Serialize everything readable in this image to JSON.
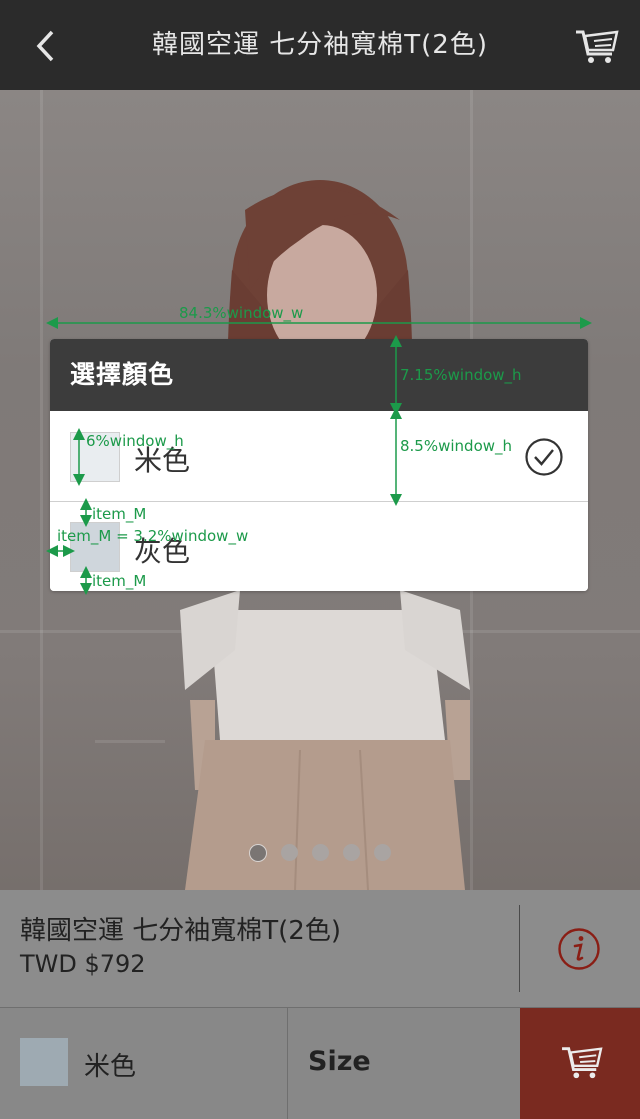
{
  "header": {
    "title": "韓國空運 七分袖寬棉T(2色)",
    "back_icon": "chevron-left-icon",
    "cart_icon": "cart-icon"
  },
  "carousel": {
    "dots": 5,
    "active_index": 0
  },
  "color_dialog": {
    "title": "選擇顏色",
    "options": [
      {
        "label": "米色",
        "selected": true
      },
      {
        "label": "灰色",
        "selected": false
      }
    ],
    "check_icon": "check-circle-icon"
  },
  "annotations": {
    "width": "84.3%window_w",
    "header_height": "7.15%window_h",
    "item_height": "8.5%window_h",
    "swatch_height": "6%window_h",
    "margin_top": "item_M",
    "margin_formula": "item_M = 3.2%window_w",
    "margin_bottom": "item_M",
    "color": "#1c9a4a"
  },
  "product": {
    "name": "韓國空運 七分袖寬棉T(2色)",
    "price": "TWD $792",
    "info_icon": "info-icon"
  },
  "actions": {
    "selected_color": "米色",
    "size_label": "Size",
    "cart_icon": "cart-icon",
    "cart_bg": "#7a2a20"
  }
}
